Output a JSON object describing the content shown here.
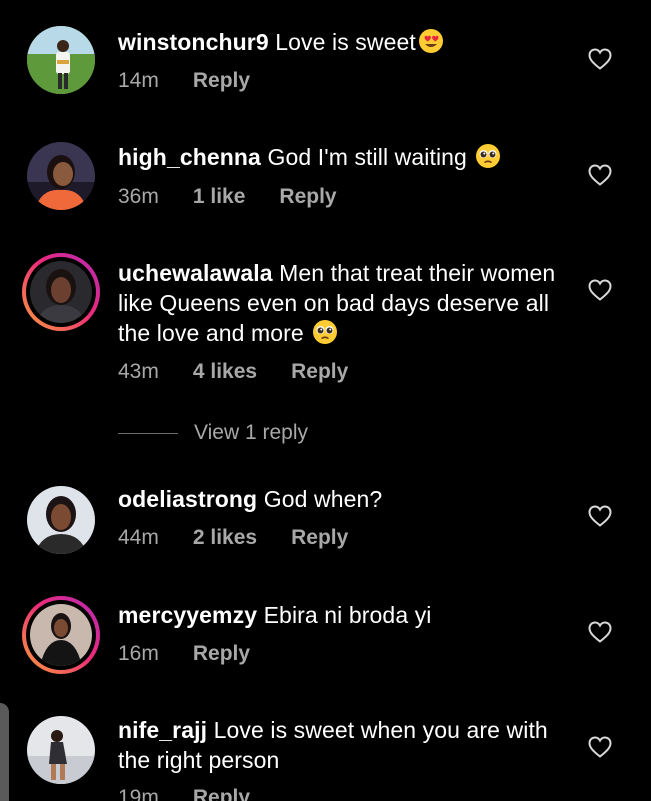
{
  "comments": [
    {
      "username": "winstonchur9",
      "text": "Love is sweet",
      "emoji_icon": "heart-eyes-emoji",
      "time": "14m",
      "likes": "",
      "reply": "Reply",
      "has_story": false
    },
    {
      "username": "high_chenna",
      "text": "God I'm still waiting",
      "emoji_icon": "pleading-face-emoji",
      "time": "36m",
      "likes": "1 like",
      "reply": "Reply",
      "has_story": false
    },
    {
      "username": "uchewalawala",
      "text": "Men that treat their women like Queens even on bad days deserve all the love and more",
      "emoji_icon": "pleading-face-emoji",
      "time": "43m",
      "likes": "4 likes",
      "reply": "Reply",
      "has_story": true
    },
    {
      "username": "odeliastrong",
      "text": "God when?",
      "emoji_icon": "",
      "time": "44m",
      "likes": "2 likes",
      "reply": "Reply",
      "has_story": false
    },
    {
      "username": "mercyyemzy",
      "text": "Ebira ni broda yi",
      "emoji_icon": "",
      "time": "16m",
      "likes": "",
      "reply": "Reply",
      "has_story": true
    },
    {
      "username": "nife_rajj",
      "text": "Love is sweet when you are with the right person",
      "emoji_icon": "",
      "time": "19m",
      "likes": "",
      "reply": "Reply",
      "has_story": false
    }
  ],
  "view_replies": "View 1 reply",
  "colors": {
    "background": "#000000",
    "text": "#ffffff",
    "meta": "#a8a8a8",
    "story_ring_start": "#f9a23a",
    "story_ring_end": "#b02ab8"
  }
}
